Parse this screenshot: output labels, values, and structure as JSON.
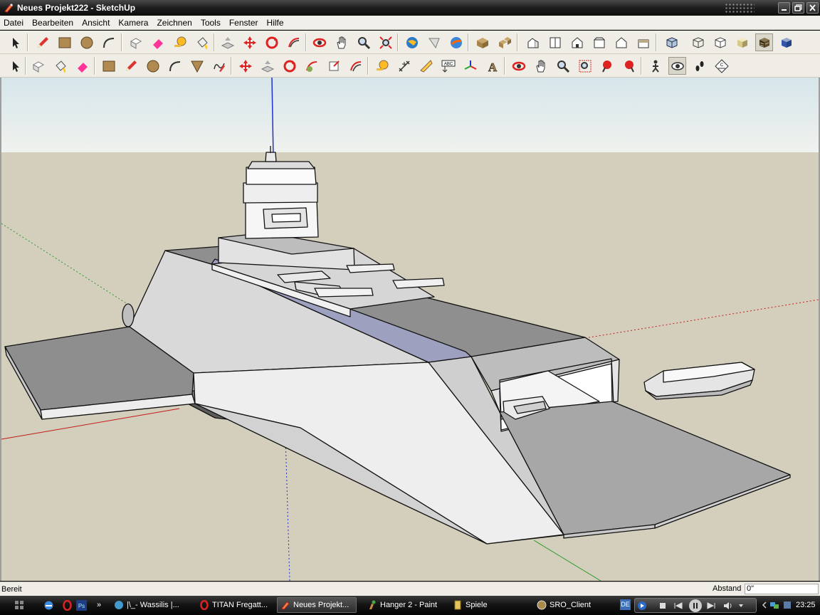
{
  "window": {
    "title": "Neues Projekt222 - SketchUp",
    "buttons": [
      "minimize",
      "restore",
      "close"
    ]
  },
  "menu": [
    "Datei",
    "Bearbeiten",
    "Ansicht",
    "Kamera",
    "Zeichnen",
    "Tools",
    "Fenster",
    "Hilfe"
  ],
  "toolbar1": [
    {
      "name": "select",
      "icon": "arrow-icon"
    },
    {
      "name": "line",
      "icon": "pencil-icon"
    },
    {
      "name": "rectangle",
      "icon": "rectangle-icon"
    },
    {
      "name": "circle",
      "icon": "circle-icon"
    },
    {
      "name": "arc",
      "icon": "arc-icon"
    },
    {
      "name": "make-component",
      "icon": "component-icon"
    },
    {
      "name": "eraser",
      "icon": "eraser-icon"
    },
    {
      "name": "tape-measure",
      "icon": "tape-icon"
    },
    {
      "name": "paint-bucket",
      "icon": "bucket-icon"
    },
    {
      "name": "push-pull",
      "icon": "pushpull-icon"
    },
    {
      "name": "move",
      "icon": "move-icon"
    },
    {
      "name": "rotate",
      "icon": "rotate-icon"
    },
    {
      "name": "follow-me",
      "icon": "followme-icon"
    },
    {
      "name": "orbit",
      "icon": "orbit-icon"
    },
    {
      "name": "pan",
      "icon": "hand-icon"
    },
    {
      "name": "zoom",
      "icon": "magnifier-icon"
    },
    {
      "name": "zoom-extents",
      "icon": "zoom-extents-icon"
    },
    {
      "name": "get-models",
      "icon": "globe-icon"
    },
    {
      "name": "share-model",
      "icon": "share-icon"
    },
    {
      "name": "google-earth",
      "icon": "earth-icon"
    },
    {
      "name": "components",
      "icon": "box-icon"
    },
    {
      "name": "materials",
      "icon": "boxes-icon"
    },
    {
      "name": "iso-view",
      "icon": "house-iso-icon"
    },
    {
      "name": "top-view",
      "icon": "house-top-icon"
    },
    {
      "name": "front-view",
      "icon": "house-front-icon"
    },
    {
      "name": "right-view",
      "icon": "house-right-icon"
    },
    {
      "name": "back-view",
      "icon": "house-back-icon"
    },
    {
      "name": "left-view",
      "icon": "house-left-icon"
    },
    {
      "name": "xray",
      "icon": "xray-cube-icon"
    },
    {
      "name": "wireframe",
      "icon": "wire-cube-icon"
    },
    {
      "name": "hidden-line",
      "icon": "hidden-cube-icon"
    },
    {
      "name": "shaded",
      "icon": "shaded-cube-icon"
    },
    {
      "name": "shaded-textures",
      "icon": "texture-cube-icon"
    },
    {
      "name": "monochrome",
      "icon": "mono-cube-icon"
    }
  ],
  "toolbar2": [
    {
      "name": "select",
      "icon": "arrow-icon"
    },
    {
      "name": "make-component",
      "icon": "component-icon"
    },
    {
      "name": "paint-bucket",
      "icon": "bucket-icon"
    },
    {
      "name": "eraser",
      "icon": "eraser-icon"
    },
    {
      "name": "rectangle",
      "icon": "rectangle-icon"
    },
    {
      "name": "line",
      "icon": "pencil-icon"
    },
    {
      "name": "circle",
      "icon": "circle-icon"
    },
    {
      "name": "arc",
      "icon": "arc-icon"
    },
    {
      "name": "polygon",
      "icon": "polygon-icon"
    },
    {
      "name": "freehand",
      "icon": "freehand-icon"
    },
    {
      "name": "move",
      "icon": "move-icon"
    },
    {
      "name": "push-pull",
      "icon": "pushpull-icon"
    },
    {
      "name": "rotate",
      "icon": "rotate-icon"
    },
    {
      "name": "follow-me",
      "icon": "followme-icon"
    },
    {
      "name": "scale",
      "icon": "scale-icon"
    },
    {
      "name": "offset",
      "icon": "offset-icon"
    },
    {
      "name": "tape-measure",
      "icon": "tape-icon"
    },
    {
      "name": "dimension",
      "icon": "dimension-icon"
    },
    {
      "name": "protractor",
      "icon": "protractor-icon"
    },
    {
      "name": "text",
      "icon": "text-icon",
      "label": "ABC"
    },
    {
      "name": "axes",
      "icon": "axes-icon"
    },
    {
      "name": "3d-text",
      "icon": "3d-text-icon",
      "label": "A"
    },
    {
      "name": "orbit",
      "icon": "orbit-icon"
    },
    {
      "name": "pan",
      "icon": "hand-icon"
    },
    {
      "name": "zoom",
      "icon": "magnifier-icon"
    },
    {
      "name": "zoom-window",
      "icon": "zoom-window-icon"
    },
    {
      "name": "previous-view",
      "icon": "previous-icon"
    },
    {
      "name": "next-view",
      "icon": "next-icon"
    },
    {
      "name": "position-camera",
      "icon": "camera-person-icon"
    },
    {
      "name": "look-around",
      "icon": "eye-icon"
    },
    {
      "name": "walk",
      "icon": "footprints-icon"
    },
    {
      "name": "section-plane",
      "icon": "section-icon",
      "label": "C"
    }
  ],
  "viewport": {
    "colors": {
      "sky_top": "#d6e5ea",
      "sky_bottom": "#f0f2ee",
      "ground": "#d4cfbc",
      "red_axis": "#c41a1a",
      "green_axis": "#2b9a2b",
      "blue_axis": "#2030d0"
    }
  },
  "status": {
    "text": "Bereit",
    "measure_label": "Abstand",
    "measure_value": "0\""
  },
  "taskbar": {
    "tasks": [
      {
        "label": "|\\_-  Wassilis  |...",
        "icon": "sketchup-icon",
        "active": false
      },
      {
        "label": "TITAN Fregatt...",
        "icon": "opera-icon",
        "active": false
      },
      {
        "label": "Neues Projekt...",
        "icon": "sketchup-icon",
        "active": true
      },
      {
        "label": "Hanger 2 - Paint",
        "icon": "paint-icon",
        "active": false
      },
      {
        "label": "Spiele",
        "icon": "folder-icon",
        "active": false
      },
      {
        "label": "SRO_Client",
        "icon": "game-icon",
        "active": false
      }
    ],
    "language": "DE",
    "clock": "23:25"
  }
}
